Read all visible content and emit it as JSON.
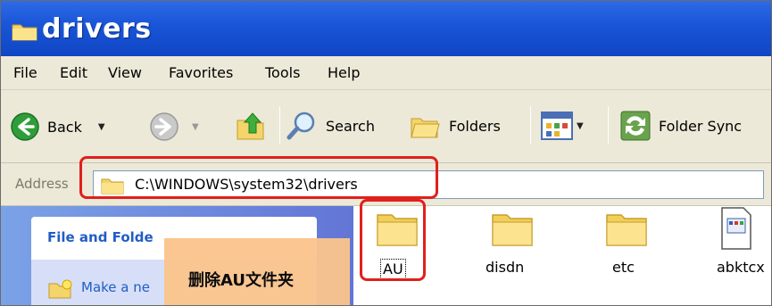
{
  "window": {
    "title": "drivers"
  },
  "menu": {
    "items": [
      "File",
      "Edit",
      "View",
      "Favorites",
      "Tools",
      "Help"
    ]
  },
  "toolbar": {
    "back_label": "Back",
    "search_label": "Search",
    "folders_label": "Folders",
    "folder_sync_label": "Folder Sync"
  },
  "address": {
    "label": "Address",
    "path": "C:\\WINDOWS\\system32\\drivers"
  },
  "task_pane": {
    "title": "File and Folde",
    "items": [
      "Make a ne"
    ]
  },
  "annotation": {
    "text": "删除AU文件夹",
    "highlight_color": "#e0201c",
    "box_color": "#fbc48c"
  },
  "files": [
    {
      "name": "AU",
      "icon": "folder-icon",
      "selected": true
    },
    {
      "name": "disdn",
      "icon": "folder-icon"
    },
    {
      "name": "etc",
      "icon": "folder-icon"
    },
    {
      "name": "abktcx",
      "icon": "system-file-icon"
    }
  ]
}
